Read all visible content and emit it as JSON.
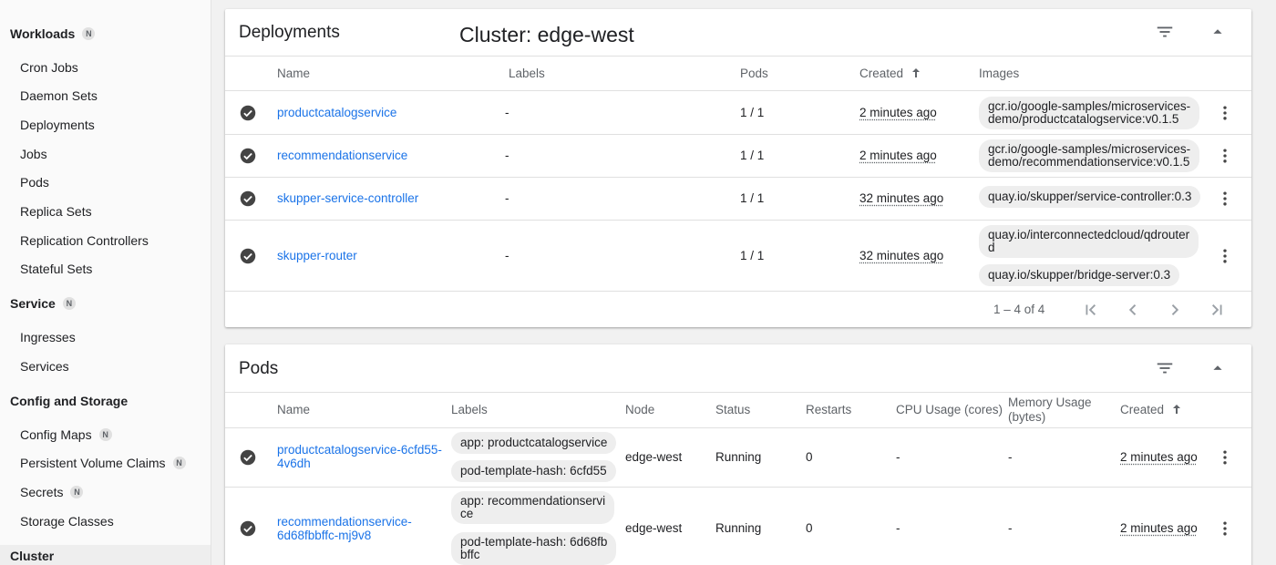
{
  "sidebar": {
    "workloads": {
      "title": "Workloads",
      "badge": "N"
    },
    "workload_items": [
      "Cron Jobs",
      "Daemon Sets",
      "Deployments",
      "Jobs",
      "Pods",
      "Replica Sets",
      "Replication Controllers",
      "Stateful Sets"
    ],
    "service": {
      "title": "Service",
      "badge": "N"
    },
    "service_items": [
      "Ingresses",
      "Services"
    ],
    "config": {
      "title": "Config and Storage"
    },
    "config_items": [
      {
        "label": "Config Maps",
        "badge": "N"
      },
      {
        "label": "Persistent Volume Claims",
        "badge": "N"
      },
      {
        "label": "Secrets",
        "badge": "N"
      },
      {
        "label": "Storage Classes",
        "badge": ""
      }
    ],
    "cluster": {
      "title": "Cluster"
    }
  },
  "deployments": {
    "title": "Deployments",
    "cluster_label": "Cluster: edge-west",
    "columns": {
      "name": "Name",
      "labels": "Labels",
      "pods": "Pods",
      "created": "Created",
      "images": "Images"
    },
    "rows": [
      {
        "name": "productcatalogservice",
        "labels": "-",
        "pods": "1 / 1",
        "created": "2 minutes ago",
        "images": [
          "gcr.io/google-samples/microservices-demo/productcatalogservice:v0.1.5"
        ],
        "image_lines": [
          [
            "gcr.io/google-samples/microservices-",
            "demo/productcatalogservice:v0.1.5"
          ]
        ]
      },
      {
        "name": "recommendationservice",
        "labels": "-",
        "pods": "1 / 1",
        "created": "2 minutes ago",
        "images": [
          "gcr.io/google-samples/microservices-demo/recommendationservice:v0.1.5"
        ],
        "image_lines": [
          [
            "gcr.io/google-samples/microservices-",
            "demo/recommendationservice:v0.1.5"
          ]
        ]
      },
      {
        "name": "skupper-service-controller",
        "labels": "-",
        "pods": "1 / 1",
        "created": "32 minutes ago",
        "images": [
          "quay.io/skupper/service-controller:0.3"
        ],
        "image_lines": [
          [
            "quay.io/skupper/service-controller:0.3"
          ]
        ]
      },
      {
        "name": "skupper-router",
        "labels": "-",
        "pods": "1 / 1",
        "created": "32 minutes ago",
        "images": [
          "quay.io/interconnectedcloud/qdrouterd",
          "quay.io/skupper/bridge-server:0.3"
        ],
        "image_lines": [
          [
            "quay.io/interconnectedcloud/qdrouter",
            "d"
          ],
          [
            "quay.io/skupper/bridge-server:0.3"
          ]
        ]
      }
    ],
    "pagination": "1 – 4 of 4"
  },
  "pods": {
    "title": "Pods",
    "columns": {
      "name": "Name",
      "labels": "Labels",
      "node": "Node",
      "status": "Status",
      "restarts": "Restarts",
      "cpu": "CPU Usage (cores)",
      "memory_l1": "Memory Usage",
      "memory_l2": "(bytes)",
      "created": "Created"
    },
    "rows": [
      {
        "name_l1": "productcatalogservice-6cfd55-",
        "name_l2": "4v6dh",
        "labels": [
          [
            "app: productcatalogservice"
          ],
          [
            "pod-template-hash: 6cfd55"
          ]
        ],
        "node": "edge-west",
        "status": "Running",
        "restarts": "0",
        "cpu": "-",
        "memory": "-",
        "created": "2 minutes ago"
      },
      {
        "name_l1": "recommendationservice-",
        "name_l2": "6d68fbbffc-mj9v8",
        "labels": [
          [
            "app: recommendationservi",
            "ce"
          ],
          [
            "pod-template-hash: 6d68fb",
            "bffc"
          ]
        ],
        "node": "edge-west",
        "status": "Running",
        "restarts": "0",
        "cpu": "-",
        "memory": "-",
        "created": "2 minutes ago"
      }
    ]
  },
  "colors": {
    "link": "#1a73e8",
    "check": "#444444",
    "chip_bg": "#eeeeee"
  }
}
